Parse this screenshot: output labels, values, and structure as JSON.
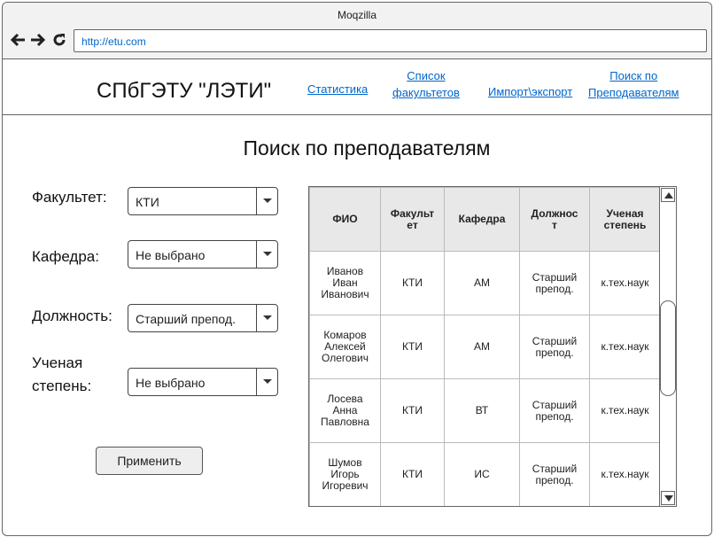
{
  "browser": {
    "title": "Moqzilla",
    "url": "http://etu.com"
  },
  "header": {
    "logo": "СПбГЭТУ \"ЛЭТИ\"",
    "nav": [
      {
        "label_lines": [
          "Статистика"
        ]
      },
      {
        "label_lines": [
          "Список",
          "факультетов"
        ]
      },
      {
        "label_lines": [
          "Импорт\\экспорт"
        ]
      },
      {
        "label_lines": [
          "Поиск по",
          "Преподавателям"
        ]
      }
    ]
  },
  "page": {
    "title": "Поиск по преподавателям"
  },
  "filters": {
    "faculty": {
      "label": "Факультет:",
      "value": "КТИ"
    },
    "department": {
      "label": "Кафедра:",
      "value": "Не выбрано"
    },
    "position": {
      "label": "Должность:",
      "value": "Старший препод."
    },
    "degree": {
      "label_lines": [
        "Ученая",
        "степень:"
      ],
      "value": "Не выбрано"
    },
    "apply_label": "Применить"
  },
  "results": {
    "columns": [
      [
        "ФИО"
      ],
      [
        "Факульт",
        "ет"
      ],
      [
        "Кафедра"
      ],
      [
        "Должнос",
        "т"
      ],
      [
        "Ученая",
        "степень"
      ]
    ],
    "rows": [
      {
        "name": [
          "Иванов",
          "Иван",
          "Иванович"
        ],
        "faculty": "КТИ",
        "department": "АМ",
        "position": [
          "Старший",
          "препод."
        ],
        "degree": "к.тех.наук"
      },
      {
        "name": [
          "Комаров",
          "Алексей",
          "Олегович"
        ],
        "faculty": "КТИ",
        "department": "АМ",
        "position": [
          "Старший",
          "препод."
        ],
        "degree": "к.тех.наук"
      },
      {
        "name": [
          "Лосева",
          "Анна",
          "Павловна"
        ],
        "faculty": "КТИ",
        "department": "ВТ",
        "position": [
          "Старший",
          "препод."
        ],
        "degree": "к.тех.наук"
      },
      {
        "name": [
          "Шумов",
          "Игорь",
          "Игоревич"
        ],
        "faculty": "КТИ",
        "department": "ИС",
        "position": [
          "Старший",
          "препод."
        ],
        "degree": "к.тех.наук"
      }
    ]
  }
}
